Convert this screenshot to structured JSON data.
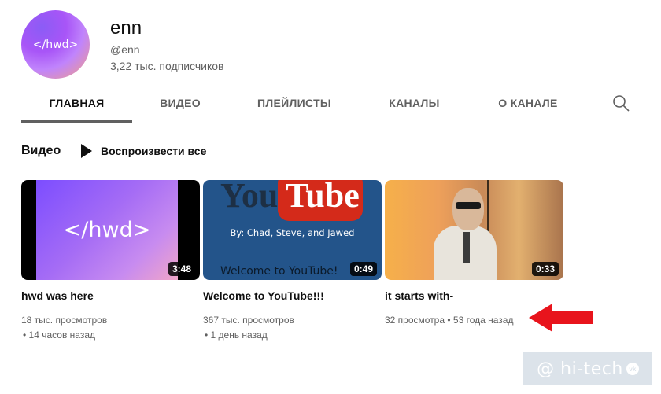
{
  "channel": {
    "avatar_text": "</hwd>",
    "name": "enn",
    "handle": "@enn",
    "subscribers": "3,22 тыс. подписчиков"
  },
  "tabs": [
    {
      "label": "ГЛАВНАЯ",
      "active": true
    },
    {
      "label": "ВИДЕО",
      "active": false
    },
    {
      "label": "ПЛЕЙЛИСТЫ",
      "active": false
    },
    {
      "label": "КАНАЛЫ",
      "active": false
    },
    {
      "label": "О КАНАЛЕ",
      "active": false
    }
  ],
  "search_icon": "search-icon",
  "section": {
    "title": "Видео",
    "play_all": "Воспроизвести все"
  },
  "videos": [
    {
      "thumb_text": "</hwd>",
      "duration": "3:48",
      "title": "hwd was here",
      "views": "18 тыс. просмотров",
      "age": "• 14 часов назад"
    },
    {
      "thumb_you": "You",
      "thumb_tube": "Tube",
      "thumb_by": "By: Chad, Steve, and Jawed",
      "thumb_welcome": "Welcome to YouTube!",
      "duration": "0:49",
      "title": "Welcome to YouTube!!!",
      "views": "367 тыс. просмотров",
      "age": "• 1 день назад"
    },
    {
      "duration": "0:33",
      "title": "it starts with-",
      "meta_line": "32 просмотра • 53 года назад"
    }
  ],
  "watermark": {
    "text": "@ hi-tech",
    "badge": "vk"
  },
  "colors": {
    "accent_red": "#e8141c",
    "text_primary": "#0f0f0f",
    "text_secondary": "#606060"
  }
}
